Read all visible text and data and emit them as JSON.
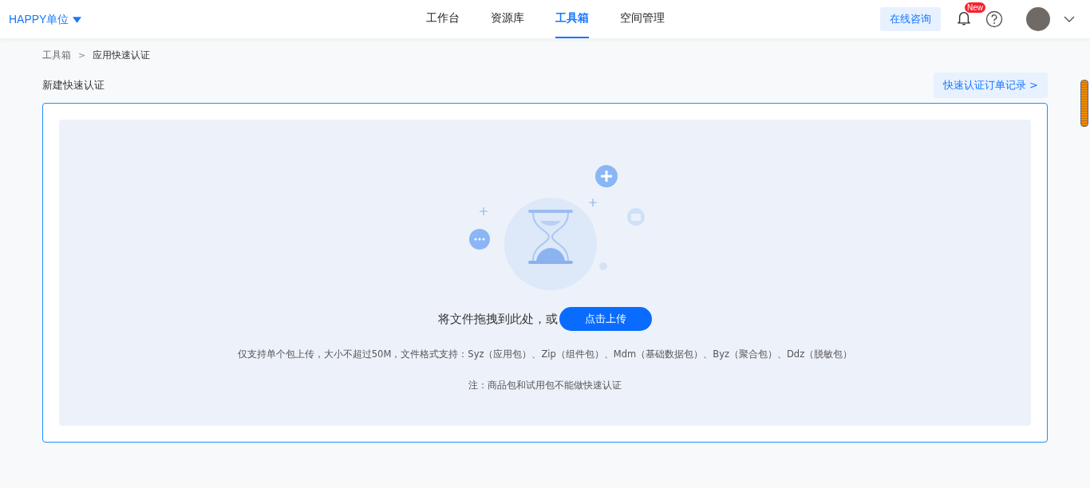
{
  "header": {
    "org": "HAPPY单位",
    "nav": [
      {
        "label": "工作台",
        "selected": false
      },
      {
        "label": "资源库",
        "selected": false
      },
      {
        "label": "工具箱",
        "selected": true
      },
      {
        "label": "空间管理",
        "selected": false
      }
    ],
    "consult": "在线咨询",
    "badge": "New"
  },
  "breadcrumb": [
    "工具箱",
    "应用快速认证"
  ],
  "breadcrumb_sep": ">",
  "title": "新建快速认证",
  "records_link": "快速认证订单记录 >",
  "upload": {
    "prompt": "将文件拖拽到此处，或",
    "button": "点击上传",
    "hint": "仅支持单个包上传，大小不超过50M，文件格式支持：Syz（应用包）、Zip（组件包）、Mdm（基础数据包）、Byz（聚合包）、Ddz（脱敏包）",
    "note": "注：商品包和试用包不能做快速认证"
  }
}
